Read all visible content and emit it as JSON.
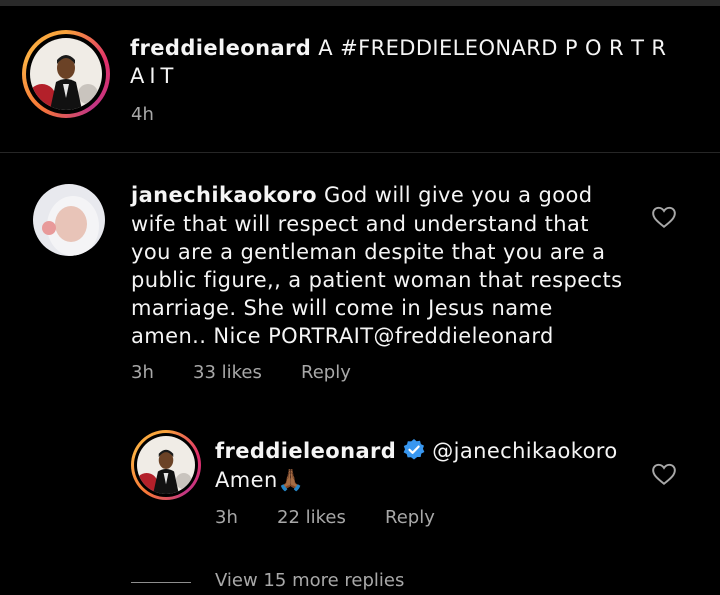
{
  "post": {
    "username": "freddieleonard",
    "caption_line1": "A #FREDDIELEONARD P O R T R",
    "caption_line2": "AIT",
    "time": "4h"
  },
  "comment": {
    "username": "janechikaokoro",
    "text_line1": "God will give you a good",
    "lines": [
      "wife that will respect and understand  that",
      "you are a gentleman despite that you are a",
      "public figure,, a patient woman that respects",
      "marriage. She will come in Jesus name",
      "amen.. Nice PORTRAIT@freddieleonard"
    ],
    "time": "3h",
    "likes": "33 likes",
    "reply": "Reply"
  },
  "reply_comment": {
    "username": "freddieleonard",
    "mention": "@janechikaokoro",
    "text": "Amen🙏🏾",
    "time": "3h",
    "likes": "22 likes",
    "reply": "Reply"
  },
  "view_more": "View 15 more replies",
  "icons": {
    "heart": "heart-outline-icon",
    "verified": "verified-badge-icon"
  },
  "colors": {
    "background": "#000000",
    "text": "#f5f5f5",
    "meta": "#a8a8a8",
    "verified": "#3897f0"
  }
}
